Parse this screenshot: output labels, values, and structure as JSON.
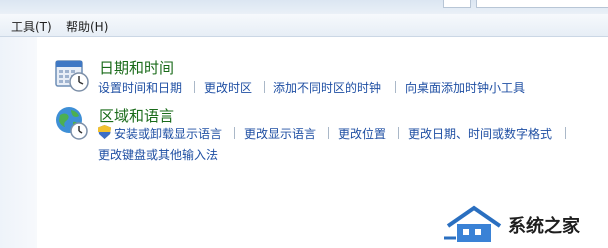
{
  "menubar": {
    "items": [
      {
        "label": "工具(T)"
      },
      {
        "label": "帮助(H)"
      }
    ]
  },
  "categories": [
    {
      "title": "日期和时间",
      "icon": "calendar-clock-icon",
      "links": [
        "设置时间和日期",
        "更改时区",
        "添加不同时区的时钟",
        "向桌面添加时钟小工具"
      ]
    },
    {
      "title": "区域和语言",
      "icon": "globe-clock-icon",
      "links": [
        "安装或卸载显示语言",
        "更改显示语言",
        "更改位置",
        "更改日期、时间或数字格式",
        "更改键盘或其他输入法"
      ]
    }
  ],
  "watermark": {
    "text": "系统之家"
  },
  "colors": {
    "title_green": "#1a6b1a",
    "link_blue": "#1f4fa3"
  }
}
